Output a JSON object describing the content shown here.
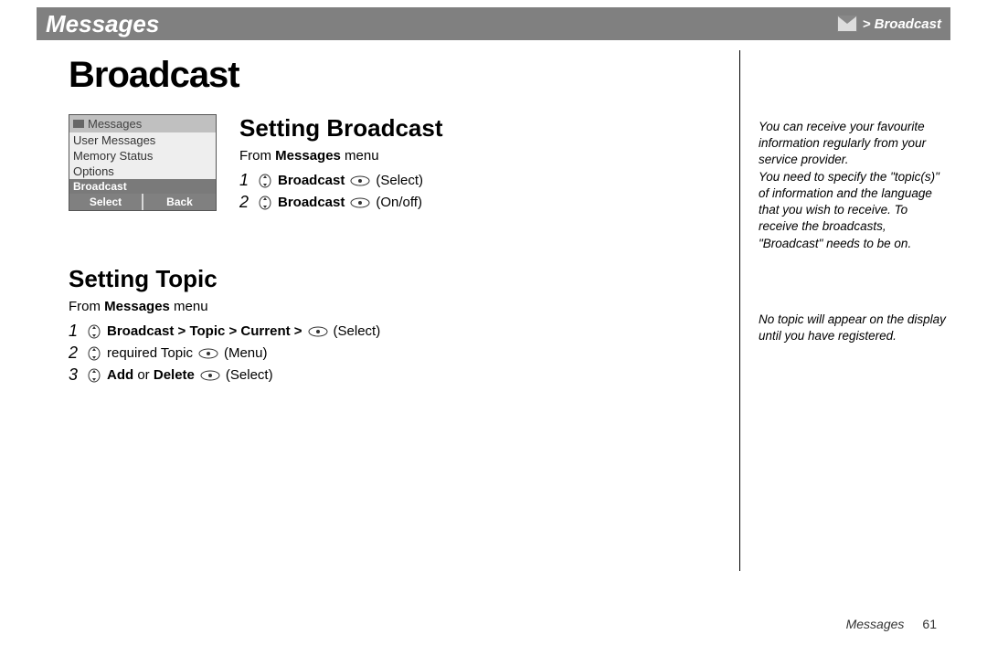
{
  "header": {
    "section_title": "Messages",
    "breadcrumb": "> Broadcast"
  },
  "page_title": "Broadcast",
  "phone": {
    "title": "Messages",
    "items": [
      "User Messages",
      "Memory Status",
      "Options"
    ],
    "selected": "Broadcast",
    "softkey_left": "Select",
    "softkey_right": "Back"
  },
  "setting_broadcast": {
    "heading": "Setting Broadcast",
    "from_prefix": "From ",
    "from_bold": "Messages",
    "from_suffix": " menu",
    "step1_bold": "Broadcast",
    "step1_action": "(Select)",
    "step2_bold": "Broadcast",
    "step2_action": "(On/off)"
  },
  "setting_topic": {
    "heading": "Setting Topic",
    "from_prefix": "From ",
    "from_bold": "Messages",
    "from_suffix": " menu",
    "step1_bold": "Broadcast > Topic > Current > ",
    "step1_action": "(Select)",
    "step2_plain": " required Topic ",
    "step2_action": "(Menu)",
    "step3_bold1": "Add",
    "step3_mid": " or ",
    "step3_bold2": "Delete",
    "step3_action": "(Select)"
  },
  "side_notes": {
    "n1": "You can receive your favourite information regularly from your service provider.\nYou need to specify the \"topic(s)\" of information and the language that you wish to receive. To receive the broadcasts, \"Broadcast\" needs to be on.",
    "n2": "No topic will appear on the display until you have registered."
  },
  "footer": {
    "label": "Messages",
    "page": "61"
  }
}
